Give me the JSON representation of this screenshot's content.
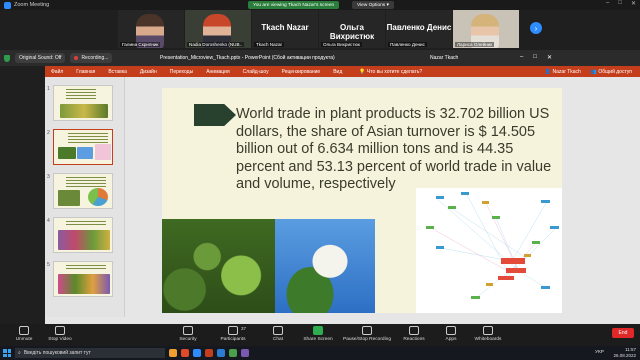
{
  "window": {
    "title": "Zoom Meeting"
  },
  "share_banner": "You are viewing Tkach Nazar's screen",
  "view_options": "View Options ▾",
  "participants": [
    {
      "name": "Галина Скрипник",
      "video": true
    },
    {
      "name": "Nadia Doroshenko (NUB..",
      "video": true
    },
    {
      "name": "Tkach Nazar",
      "video": false
    },
    {
      "name": "Ольга Вихристюк",
      "video": false
    },
    {
      "name": "Павленко Денис",
      "video": false
    },
    {
      "name": "Лариса Олейник",
      "video": true
    }
  ],
  "share_toolbar": {
    "sound": "Original Sound: Off",
    "recording": "Recording..."
  },
  "ppt": {
    "title": "Presentation_Microview_Tkach.pptx - PowerPoint (Сбой активации продукта)",
    "user": "Nazar Tkach",
    "ribbon": [
      "Файл",
      "Главная",
      "Вставка",
      "Дизайн",
      "Переходы",
      "Анимация",
      "Слайд-шоу",
      "Рецензирование",
      "Вид"
    ],
    "tell_me": "Что вы хотите сделать?",
    "share": "Общий доступ"
  },
  "slide": {
    "text": "World trade in plant products is 32.702 billion US dollars, the share of Asian turnover is $ 14.505 billion out of 6.634 million tons and is 44.35 percent and 53.13 percent of world trade in value and volume, respectively"
  },
  "thumbnails": [
    "1",
    "2",
    "3",
    "4",
    "5"
  ],
  "zoom_toolbar": [
    {
      "label": "Unmute",
      "icon": "microphone-icon"
    },
    {
      "label": "Stop Video",
      "icon": "video-camera-icon"
    },
    {
      "label": "Security",
      "icon": "shield-icon"
    },
    {
      "label": "Participants",
      "icon": "people-icon",
      "count": "37"
    },
    {
      "label": "Chat",
      "icon": "chat-icon"
    },
    {
      "label": "Share Screen",
      "icon": "share-screen-icon"
    },
    {
      "label": "Pause/Stop Recording",
      "icon": "record-icon"
    },
    {
      "label": "Reactions",
      "icon": "smile-icon"
    },
    {
      "label": "Apps",
      "icon": "apps-icon"
    },
    {
      "label": "Whiteboards",
      "icon": "whiteboard-icon"
    }
  ],
  "end_label": "End",
  "taskbar": {
    "search": "Введіть пошуковий запит тут",
    "lang": "УКР",
    "time": "11:57",
    "date": "26.08.2022"
  }
}
